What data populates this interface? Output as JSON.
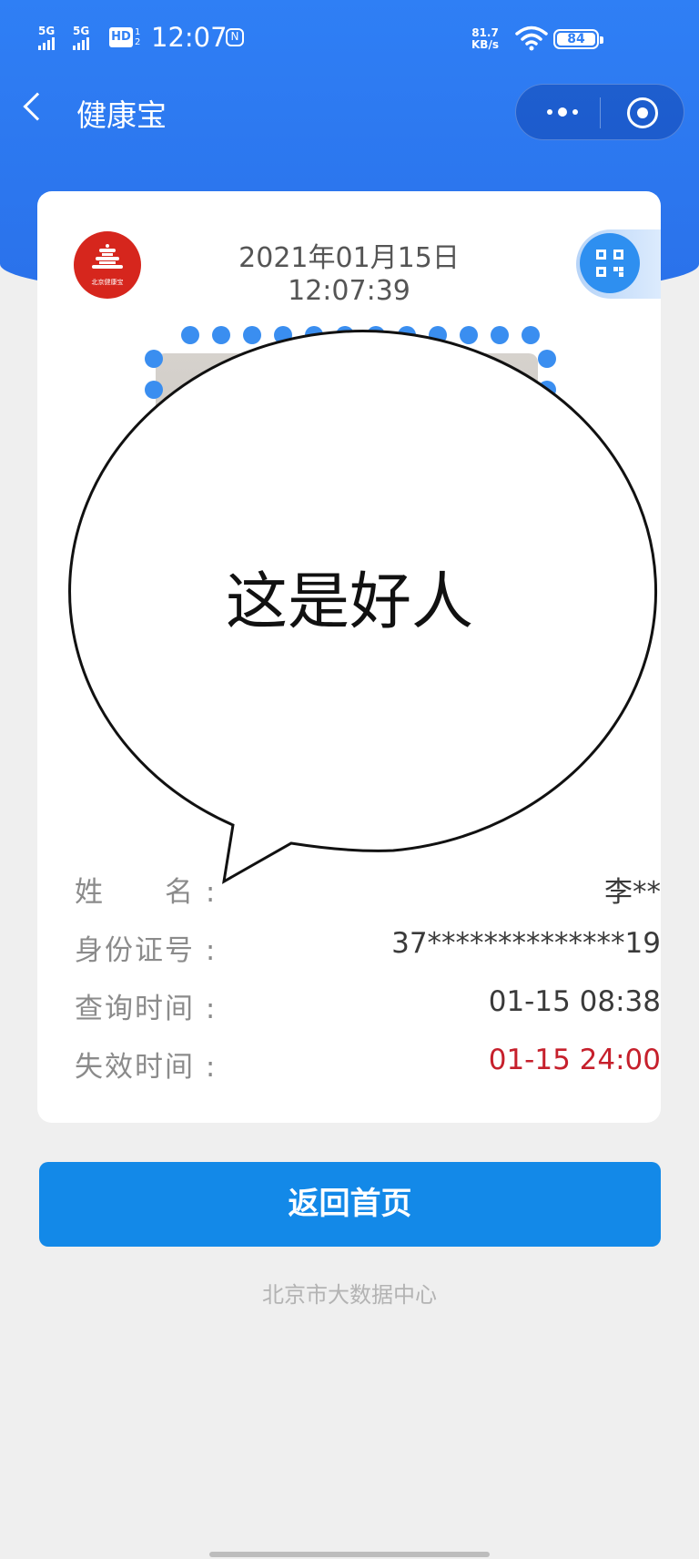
{
  "status_bar": {
    "signal1": "5G",
    "signal2": "5G",
    "hd": "HD",
    "hd_sub1": "1",
    "hd_sub2": "2",
    "time": "12:07",
    "net_speed_value": "81.7",
    "net_speed_unit": "KB/s",
    "battery": "84"
  },
  "nav": {
    "title": "健康宝"
  },
  "card": {
    "logo_caption": "北京健康宝",
    "date": "2021年01月15日",
    "time": "12:07:39",
    "rows": [
      {
        "label": "姓　　名 :",
        "value": "李**"
      },
      {
        "label": "身份证号 :",
        "value": "37**************19"
      },
      {
        "label": "查询时间 :",
        "value": "01-15 08:38"
      },
      {
        "label": "失效时间 :",
        "value": "01-15 24:00"
      }
    ]
  },
  "home_button": "返回首页",
  "footer": "北京市大数据中心",
  "bubble_text": "这是好人",
  "colors": {
    "header_blue": "#2f7ff5",
    "button_blue": "#1389e8",
    "expiry_red": "#c6202c"
  }
}
